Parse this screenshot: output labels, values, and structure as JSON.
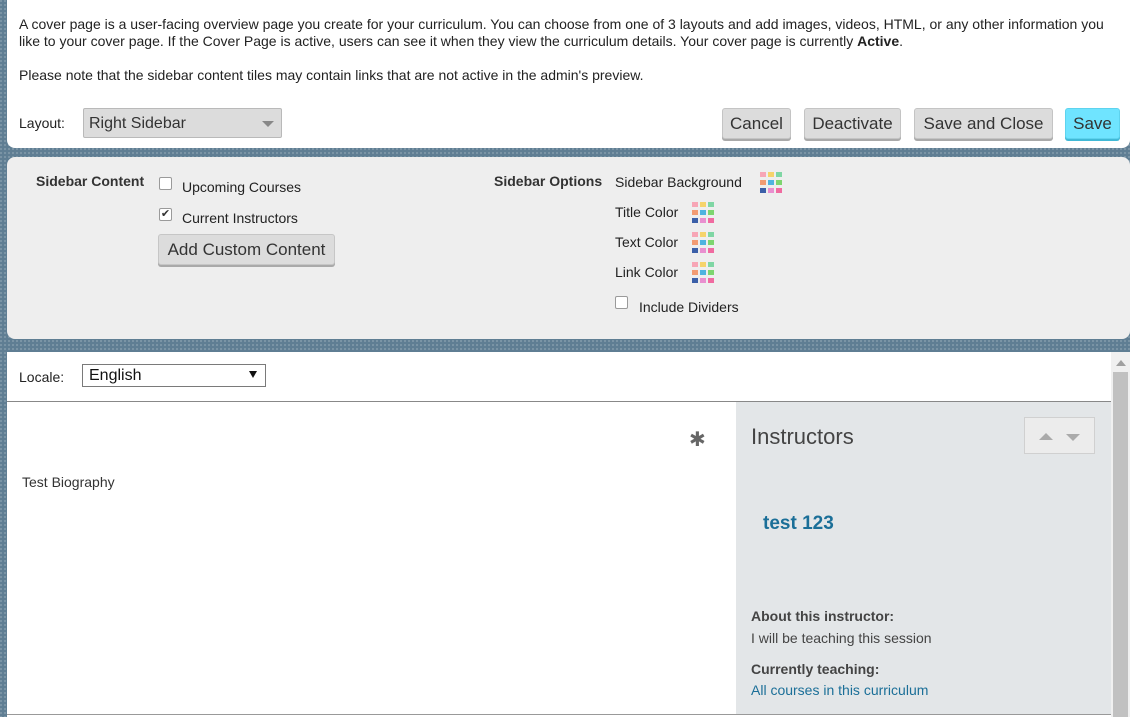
{
  "intro": {
    "text_main": "A cover page is a user-facing overview page you create for your curriculum. You can choose from one of 3 layouts and add images, videos, HTML, or any other information you like to your cover page. If the Cover Page is active, users can see it when they view the curriculum details. Your cover page is currently ",
    "status": "Active",
    "text_end": ".",
    "note": "Please note that the sidebar content tiles may contain links that are not active in the admin's preview."
  },
  "layout": {
    "label": "Layout:",
    "value": "Right Sidebar"
  },
  "toolbar": {
    "cancel": "Cancel",
    "deactivate": "Deactivate",
    "save_close": "Save and Close",
    "save": "Save"
  },
  "sidebar_content": {
    "label": "Sidebar Content",
    "items": [
      {
        "label": "Upcoming Courses",
        "checked": false
      },
      {
        "label": "Current Instructors",
        "checked": true
      }
    ],
    "add_custom": "Add Custom Content"
  },
  "sidebar_options": {
    "label": "Sidebar Options",
    "colors": [
      {
        "label": "Sidebar Background"
      },
      {
        "label": "Title Color"
      },
      {
        "label": "Text Color"
      },
      {
        "label": "Link Color"
      }
    ],
    "include_dividers": {
      "label": "Include Dividers",
      "checked": false
    },
    "swatch_colors": [
      "#f7a6b6",
      "#f5d36b",
      "#7fd6a4",
      "#f29b73",
      "#4fb3e0",
      "#7ed56f",
      "#3b5fa8",
      "#e98fcf",
      "#f06ba0"
    ]
  },
  "locale": {
    "label": "Locale:",
    "value": "English"
  },
  "main": {
    "biography": "Test Biography",
    "gear_icon": "gear-icon"
  },
  "sidebar": {
    "title": "Instructors",
    "instructor_name": "test 123",
    "about_heading": "About this instructor:",
    "about_text": "I will be teaching this session",
    "teaching_heading": "Currently teaching:",
    "teaching_link": "All courses in this curriculum"
  },
  "colors": {
    "accent_save": "#6fe4ff",
    "link": "#1b6f98"
  }
}
